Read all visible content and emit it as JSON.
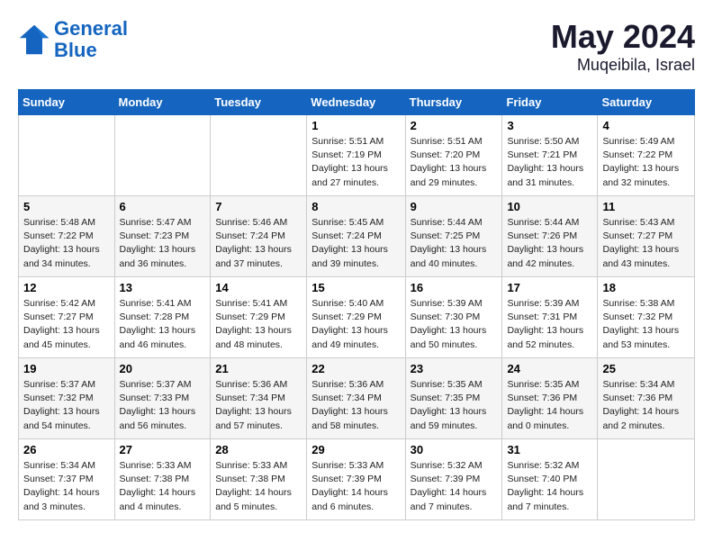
{
  "header": {
    "logo_line1": "General",
    "logo_line2": "Blue",
    "month_year": "May 2024",
    "location": "Muqeibila, Israel"
  },
  "weekdays": [
    "Sunday",
    "Monday",
    "Tuesday",
    "Wednesday",
    "Thursday",
    "Friday",
    "Saturday"
  ],
  "weeks": [
    [
      null,
      null,
      null,
      {
        "day": "1",
        "sunrise": "Sunrise: 5:51 AM",
        "sunset": "Sunset: 7:19 PM",
        "daylight": "Daylight: 13 hours and 27 minutes."
      },
      {
        "day": "2",
        "sunrise": "Sunrise: 5:51 AM",
        "sunset": "Sunset: 7:20 PM",
        "daylight": "Daylight: 13 hours and 29 minutes."
      },
      {
        "day": "3",
        "sunrise": "Sunrise: 5:50 AM",
        "sunset": "Sunset: 7:21 PM",
        "daylight": "Daylight: 13 hours and 31 minutes."
      },
      {
        "day": "4",
        "sunrise": "Sunrise: 5:49 AM",
        "sunset": "Sunset: 7:22 PM",
        "daylight": "Daylight: 13 hours and 32 minutes."
      }
    ],
    [
      {
        "day": "5",
        "sunrise": "Sunrise: 5:48 AM",
        "sunset": "Sunset: 7:22 PM",
        "daylight": "Daylight: 13 hours and 34 minutes."
      },
      {
        "day": "6",
        "sunrise": "Sunrise: 5:47 AM",
        "sunset": "Sunset: 7:23 PM",
        "daylight": "Daylight: 13 hours and 36 minutes."
      },
      {
        "day": "7",
        "sunrise": "Sunrise: 5:46 AM",
        "sunset": "Sunset: 7:24 PM",
        "daylight": "Daylight: 13 hours and 37 minutes."
      },
      {
        "day": "8",
        "sunrise": "Sunrise: 5:45 AM",
        "sunset": "Sunset: 7:24 PM",
        "daylight": "Daylight: 13 hours and 39 minutes."
      },
      {
        "day": "9",
        "sunrise": "Sunrise: 5:44 AM",
        "sunset": "Sunset: 7:25 PM",
        "daylight": "Daylight: 13 hours and 40 minutes."
      },
      {
        "day": "10",
        "sunrise": "Sunrise: 5:44 AM",
        "sunset": "Sunset: 7:26 PM",
        "daylight": "Daylight: 13 hours and 42 minutes."
      },
      {
        "day": "11",
        "sunrise": "Sunrise: 5:43 AM",
        "sunset": "Sunset: 7:27 PM",
        "daylight": "Daylight: 13 hours and 43 minutes."
      }
    ],
    [
      {
        "day": "12",
        "sunrise": "Sunrise: 5:42 AM",
        "sunset": "Sunset: 7:27 PM",
        "daylight": "Daylight: 13 hours and 45 minutes."
      },
      {
        "day": "13",
        "sunrise": "Sunrise: 5:41 AM",
        "sunset": "Sunset: 7:28 PM",
        "daylight": "Daylight: 13 hours and 46 minutes."
      },
      {
        "day": "14",
        "sunrise": "Sunrise: 5:41 AM",
        "sunset": "Sunset: 7:29 PM",
        "daylight": "Daylight: 13 hours and 48 minutes."
      },
      {
        "day": "15",
        "sunrise": "Sunrise: 5:40 AM",
        "sunset": "Sunset: 7:29 PM",
        "daylight": "Daylight: 13 hours and 49 minutes."
      },
      {
        "day": "16",
        "sunrise": "Sunrise: 5:39 AM",
        "sunset": "Sunset: 7:30 PM",
        "daylight": "Daylight: 13 hours and 50 minutes."
      },
      {
        "day": "17",
        "sunrise": "Sunrise: 5:39 AM",
        "sunset": "Sunset: 7:31 PM",
        "daylight": "Daylight: 13 hours and 52 minutes."
      },
      {
        "day": "18",
        "sunrise": "Sunrise: 5:38 AM",
        "sunset": "Sunset: 7:32 PM",
        "daylight": "Daylight: 13 hours and 53 minutes."
      }
    ],
    [
      {
        "day": "19",
        "sunrise": "Sunrise: 5:37 AM",
        "sunset": "Sunset: 7:32 PM",
        "daylight": "Daylight: 13 hours and 54 minutes."
      },
      {
        "day": "20",
        "sunrise": "Sunrise: 5:37 AM",
        "sunset": "Sunset: 7:33 PM",
        "daylight": "Daylight: 13 hours and 56 minutes."
      },
      {
        "day": "21",
        "sunrise": "Sunrise: 5:36 AM",
        "sunset": "Sunset: 7:34 PM",
        "daylight": "Daylight: 13 hours and 57 minutes."
      },
      {
        "day": "22",
        "sunrise": "Sunrise: 5:36 AM",
        "sunset": "Sunset: 7:34 PM",
        "daylight": "Daylight: 13 hours and 58 minutes."
      },
      {
        "day": "23",
        "sunrise": "Sunrise: 5:35 AM",
        "sunset": "Sunset: 7:35 PM",
        "daylight": "Daylight: 13 hours and 59 minutes."
      },
      {
        "day": "24",
        "sunrise": "Sunrise: 5:35 AM",
        "sunset": "Sunset: 7:36 PM",
        "daylight": "Daylight: 14 hours and 0 minutes."
      },
      {
        "day": "25",
        "sunrise": "Sunrise: 5:34 AM",
        "sunset": "Sunset: 7:36 PM",
        "daylight": "Daylight: 14 hours and 2 minutes."
      }
    ],
    [
      {
        "day": "26",
        "sunrise": "Sunrise: 5:34 AM",
        "sunset": "Sunset: 7:37 PM",
        "daylight": "Daylight: 14 hours and 3 minutes."
      },
      {
        "day": "27",
        "sunrise": "Sunrise: 5:33 AM",
        "sunset": "Sunset: 7:38 PM",
        "daylight": "Daylight: 14 hours and 4 minutes."
      },
      {
        "day": "28",
        "sunrise": "Sunrise: 5:33 AM",
        "sunset": "Sunset: 7:38 PM",
        "daylight": "Daylight: 14 hours and 5 minutes."
      },
      {
        "day": "29",
        "sunrise": "Sunrise: 5:33 AM",
        "sunset": "Sunset: 7:39 PM",
        "daylight": "Daylight: 14 hours and 6 minutes."
      },
      {
        "day": "30",
        "sunrise": "Sunrise: 5:32 AM",
        "sunset": "Sunset: 7:39 PM",
        "daylight": "Daylight: 14 hours and 7 minutes."
      },
      {
        "day": "31",
        "sunrise": "Sunrise: 5:32 AM",
        "sunset": "Sunset: 7:40 PM",
        "daylight": "Daylight: 14 hours and 7 minutes."
      },
      null
    ]
  ]
}
